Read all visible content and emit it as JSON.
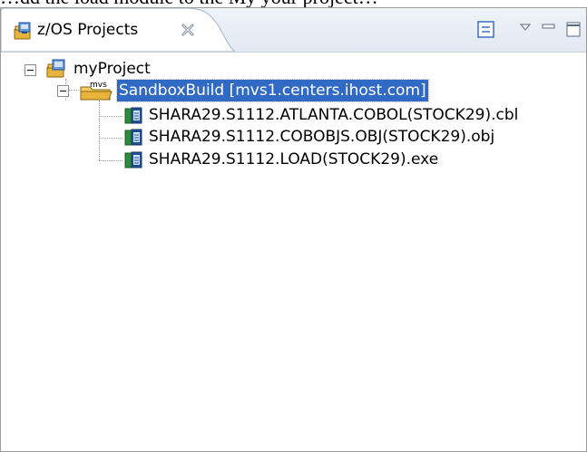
{
  "caption": "…dd the load module to the My your project…",
  "view": {
    "title": "z/OS Projects",
    "icons": {
      "view": "zos-projects-icon",
      "close": "close-icon",
      "collapse_all": "collapse-all-icon",
      "view_menu": "view-menu-icon",
      "minimize": "minimize-icon",
      "maximize": "maximize-icon"
    }
  },
  "tree": {
    "project": {
      "label": "myProject",
      "icon": "project-icon"
    },
    "subproject": {
      "label": "SandboxBuild  [mvs1.centers.ihost.com]",
      "icon": "mvs-subproject-icon",
      "selected": true
    },
    "members": [
      {
        "label": "SHARA29.S1112.ATLANTA.COBOL(STOCK29).cbl",
        "icon": "member-file-icon"
      },
      {
        "label": "SHARA29.S1112.COBOBJS.OBJ(STOCK29).obj",
        "icon": "member-file-icon"
      },
      {
        "label": "SHARA29.S1112.LOAD(STOCK29).exe",
        "icon": "member-file-icon"
      }
    ]
  },
  "colors": {
    "selection": "#316ac5",
    "tab_border": "#9fb2cc",
    "frame_border": "#9b9b9b"
  }
}
